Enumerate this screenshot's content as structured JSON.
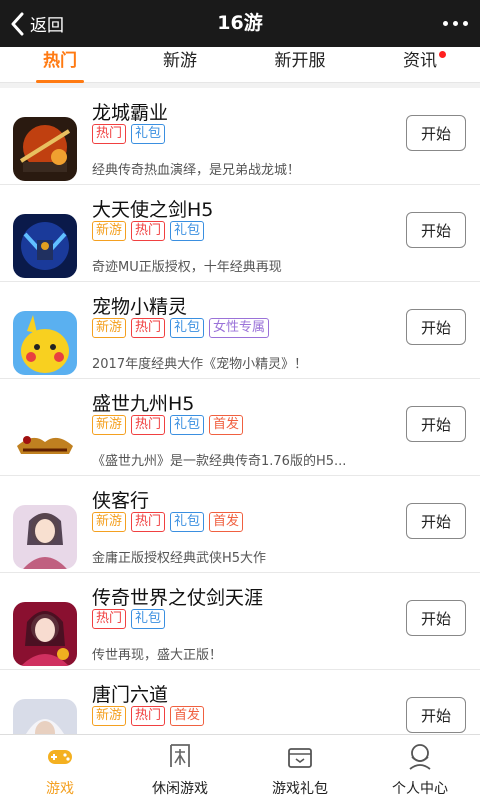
{
  "header": {
    "back_label": "返回",
    "title": "16游"
  },
  "tabs": [
    {
      "label": "热门",
      "active": true
    },
    {
      "label": "新游"
    },
    {
      "label": "新开服"
    },
    {
      "label": "资讯",
      "dot": true
    }
  ],
  "games": [
    {
      "name": "龙城霸业",
      "tags": [
        "热门",
        "礼包"
      ],
      "desc": "经典传奇热血演绎，是兄弟战龙城！",
      "button": "开始"
    },
    {
      "name": "大天使之剑H5",
      "tags": [
        "新游",
        "热门",
        "礼包"
      ],
      "desc": "奇迹MU正版授权，十年经典再现",
      "button": "开始"
    },
    {
      "name": "宠物小精灵",
      "tags": [
        "新游",
        "热门",
        "礼包",
        "女性专属"
      ],
      "desc": "2017年度经典大作《宠物小精灵》！",
      "button": "开始"
    },
    {
      "name": "盛世九州H5",
      "tags": [
        "新游",
        "热门",
        "礼包",
        "首发"
      ],
      "desc": "《盛世九州》是一款经典传奇1.76版的H5...",
      "button": "开始"
    },
    {
      "name": "侠客行",
      "tags": [
        "新游",
        "热门",
        "礼包",
        "首发"
      ],
      "desc": "金庸正版授权经典武侠H5大作",
      "button": "开始"
    },
    {
      "name": "传奇世界之仗剑天涯",
      "tags": [
        "热门",
        "礼包"
      ],
      "desc": "传世再现，盛大正版！",
      "button": "开始"
    },
    {
      "name": "唐门六道",
      "tags": [
        "新游",
        "热门",
        "首发"
      ],
      "desc": "",
      "button": "开始"
    }
  ],
  "bottom_nav": [
    {
      "label": "游戏",
      "icon": "gamepad-icon",
      "active": true
    },
    {
      "label": "休闲游戏",
      "icon": "leisure-icon"
    },
    {
      "label": "游戏礼包",
      "icon": "gift-box-icon"
    },
    {
      "label": "个人中心",
      "icon": "user-icon"
    }
  ],
  "colors": {
    "accent": "#ff7a12",
    "header_bg": "#1a1a1a"
  }
}
